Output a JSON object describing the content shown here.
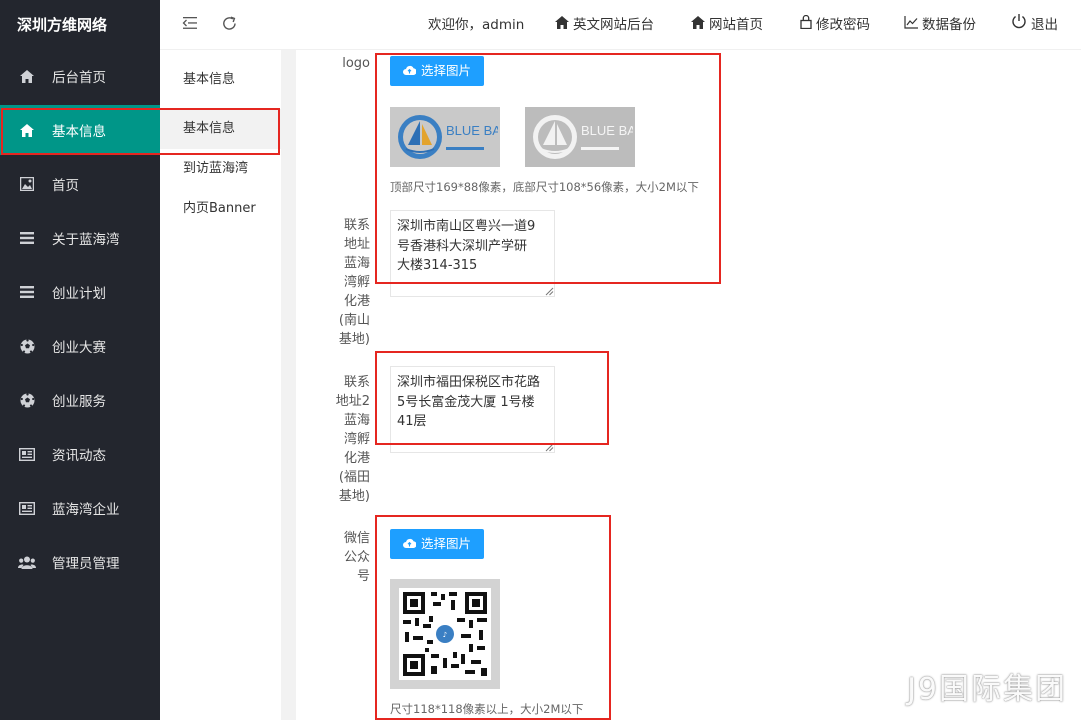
{
  "sidebar": {
    "brand": "深圳方维网络",
    "items": [
      {
        "label": "后台首页",
        "icon": "home-icon"
      },
      {
        "label": "基本信息",
        "icon": "home-icon"
      },
      {
        "label": "首页",
        "icon": "image-icon"
      },
      {
        "label": "关于蓝海湾",
        "icon": "list-icon"
      },
      {
        "label": "创业计划",
        "icon": "list-icon"
      },
      {
        "label": "创业大赛",
        "icon": "soccer-icon"
      },
      {
        "label": "创业服务",
        "icon": "soccer-icon"
      },
      {
        "label": "资讯动态",
        "icon": "news-icon"
      },
      {
        "label": "蓝海湾企业",
        "icon": "news-icon"
      },
      {
        "label": "管理员管理",
        "icon": "users-icon"
      }
    ],
    "active_index": 1,
    "active_color": "#009688"
  },
  "header": {
    "welcome": "欢迎你，admin",
    "links": [
      {
        "label": "英文网站后台",
        "icon": "home-icon"
      },
      {
        "label": "网站首页",
        "icon": "home-icon"
      },
      {
        "label": "修改密码",
        "icon": "lock-icon"
      },
      {
        "label": "数据备份",
        "icon": "chart-icon"
      },
      {
        "label": "退出",
        "icon": "power-icon"
      }
    ]
  },
  "subnav": {
    "title": "基本信息",
    "items": [
      "基本信息",
      "到访蓝海湾",
      "内页Banner"
    ],
    "active_index": 0
  },
  "form": {
    "logo": {
      "label": "logo",
      "button": "选择图片",
      "hint": "顶部尺寸169*88像素，底部尺寸108*56像素，大小2M以下",
      "thumb_text": "BLUE BAY"
    },
    "address1": {
      "label_lines": [
        "联系",
        "地址",
        "蓝海",
        "湾孵",
        "化港",
        "(南山",
        "基地)"
      ],
      "value": "深圳市南山区粤兴一道9\n号香港科大深圳产学研\n大楼314-315"
    },
    "address2": {
      "label_lines": [
        "联系",
        "地址2",
        "蓝海",
        "湾孵",
        "化港",
        "(福田",
        "基地)"
      ],
      "value": "深圳市福田保税区市花路\n5号长富金茂大厦 1号楼\n41层"
    },
    "wechat": {
      "label_lines": [
        "微信",
        "公众",
        "号"
      ],
      "button": "选择图片",
      "hint": "尺寸118*118像素以上，大小2M以下"
    }
  },
  "watermark": "J9国际集团",
  "highlight_color": "#e52620",
  "button_color": "#1e9fff"
}
